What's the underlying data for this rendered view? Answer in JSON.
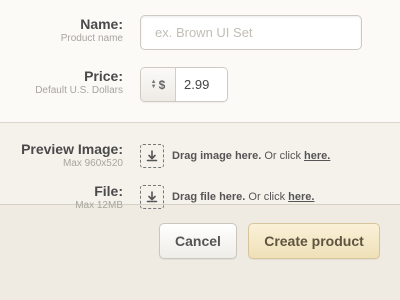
{
  "name_field": {
    "label": "Name:",
    "sublabel": "Product name",
    "placeholder": "ex. Brown UI Set",
    "value": ""
  },
  "price_field": {
    "label": "Price:",
    "sublabel": "Default U.S. Dollars",
    "currency_symbol": "$",
    "value": "2.99"
  },
  "preview_field": {
    "label": "Preview Image:",
    "sublabel": "Max 960x520",
    "drag_text": "Drag image here.",
    "or_text": " Or click ",
    "link_text": "here."
  },
  "file_field": {
    "label": "File:",
    "sublabel": "Max 12MB",
    "drag_text": "Drag file here.",
    "or_text": " Or click ",
    "link_text": "here."
  },
  "actions": {
    "cancel_label": "Cancel",
    "create_label": "Create product"
  },
  "colors": {
    "primary_button": "#f3e6c3",
    "background": "#f7f5f0"
  }
}
